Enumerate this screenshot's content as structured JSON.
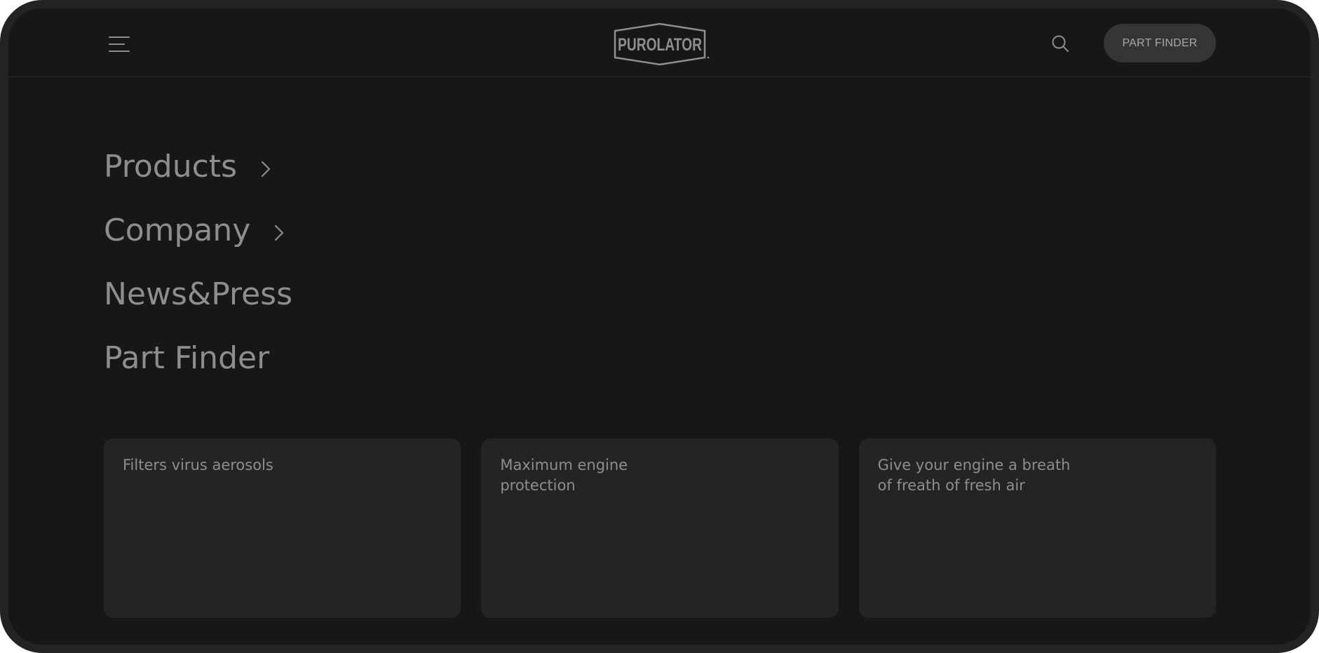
{
  "header": {
    "logo_text": "PUROLATOR",
    "part_finder_label": "PART FINDER"
  },
  "icons": {
    "menu": "hamburger-menu-icon",
    "search": "search-icon",
    "chevron": "chevron-right-icon"
  },
  "nav": {
    "items": [
      {
        "label": "Products",
        "has_submenu": true
      },
      {
        "label": "Company",
        "has_submenu": true
      },
      {
        "label": "News&Press",
        "has_submenu": false
      },
      {
        "label": "Part Finder",
        "has_submenu": false
      }
    ]
  },
  "cards": [
    {
      "title": "Filters virus aerosols"
    },
    {
      "title": "Maximum engine protection"
    },
    {
      "title": "Give your engine a breath\nof freath of fresh air"
    }
  ],
  "colors": {
    "background": "#171717",
    "card": "#242424",
    "text_muted": "#8e8e8e",
    "button_bg": "#353535"
  }
}
